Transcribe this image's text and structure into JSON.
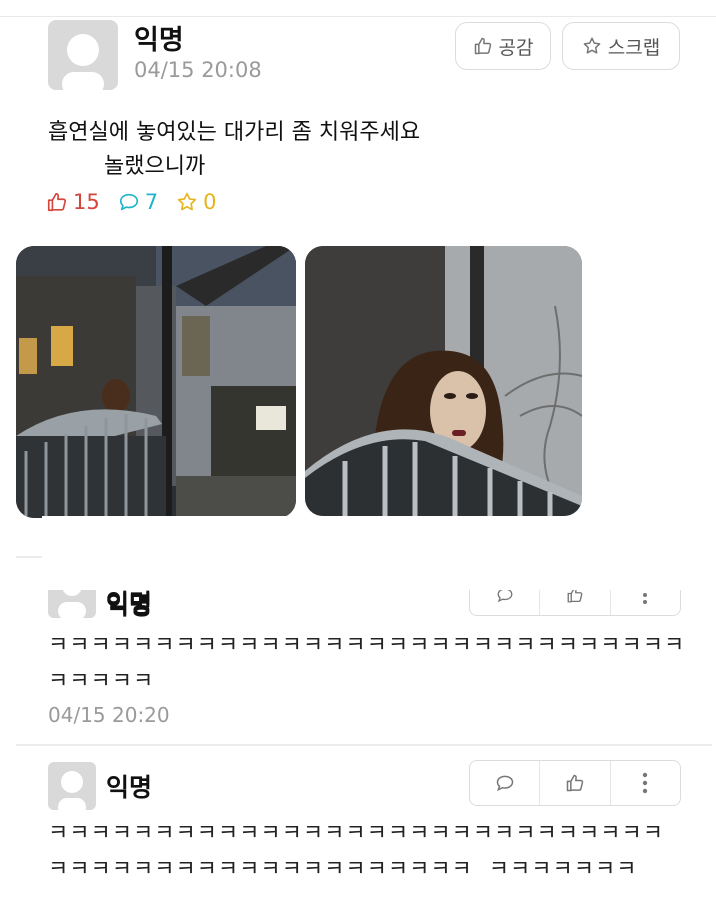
{
  "post": {
    "author": "익명",
    "time": "04/15 20:08",
    "like_button": "공감",
    "scrap_button": "스크랩",
    "body_line1": "흡연실에 놓여있는 대가리 좀 치워주세요",
    "body_line2": "놀랬으니까",
    "stats": {
      "likes": "15",
      "comments": "7",
      "scraps": "0"
    }
  },
  "comments": [
    {
      "author": "익명",
      "text": "ㅋㅋㅋㅋㅋㅋㅋㅋㅋㅋㅋㅋㅋㅋㅋㅋㅋㅋㅋㅋㅋㅋㅋㅋㅋㅋㅋㅋㅋㅋㅋㅋㅋㅋㅋ",
      "time": "04/15 20:20"
    },
    {
      "author": "익명",
      "text_line1": "ㅋㅋㅋㅋㅋㅋㅋㅋㅋㅋㅋㅋㅋㅋㅋㅋㅋㅋㅋㅋㅋㅋㅋㅋㅋㅋㅋㅋㅋ",
      "text_line2": "ㅋㅋㅋㅋㅋㅋㅋㅋㅋㅋㅋㅋㅋㅋㅋㅋㅋㅋㅋㅋ  ㅋㅋㅋㅋㅋㅋㅋ"
    }
  ],
  "icons": {
    "like": "thumbs-up-icon",
    "comment": "speech-bubble-icon",
    "scrap": "star-icon",
    "more": "more-vertical-icon"
  }
}
